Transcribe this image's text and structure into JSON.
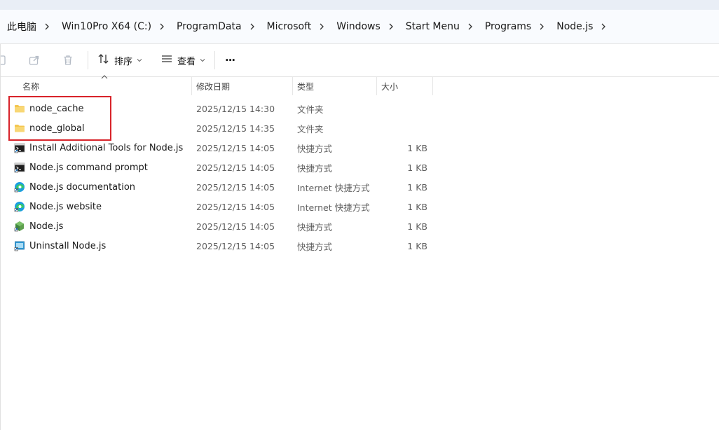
{
  "breadcrumb": {
    "items": [
      "此电脑",
      "Win10Pro X64 (C:)",
      "ProgramData",
      "Microsoft",
      "Windows",
      "Start Menu",
      "Programs",
      "Node.js"
    ]
  },
  "toolbar": {
    "sort_label": "排序",
    "view_label": "查看",
    "more_label": "···"
  },
  "columns": {
    "name": "名称",
    "date": "修改日期",
    "type": "类型",
    "size": "大小"
  },
  "files": [
    {
      "name": "node_cache",
      "date": "2025/12/15 14:30",
      "type": "文件夹",
      "size": "",
      "icon": "folder-icon"
    },
    {
      "name": "node_global",
      "date": "2025/12/15 14:35",
      "type": "文件夹",
      "size": "",
      "icon": "folder-icon"
    },
    {
      "name": "Install Additional Tools for Node.js",
      "date": "2025/12/15 14:05",
      "type": "快捷方式",
      "size": "1 KB",
      "icon": "terminal-shortcut-icon"
    },
    {
      "name": "Node.js command prompt",
      "date": "2025/12/15 14:05",
      "type": "快捷方式",
      "size": "1 KB",
      "icon": "terminal-shortcut-icon"
    },
    {
      "name": "Node.js documentation",
      "date": "2025/12/15 14:05",
      "type": "Internet 快捷方式",
      "size": "1 KB",
      "icon": "edge-browser-icon"
    },
    {
      "name": "Node.js website",
      "date": "2025/12/15 14:05",
      "type": "Internet 快捷方式",
      "size": "1 KB",
      "icon": "edge-browser-icon"
    },
    {
      "name": "Node.js",
      "date": "2025/12/15 14:05",
      "type": "快捷方式",
      "size": "1 KB",
      "icon": "nodejs-hexagon-icon"
    },
    {
      "name": "Uninstall Node.js",
      "date": "2025/12/15 14:05",
      "type": "快捷方式",
      "size": "1 KB",
      "icon": "uninstall-icon"
    }
  ],
  "colors": {
    "highlight": "#d8232a",
    "folder": "#f4c64f",
    "accent": "#0f6cbd"
  }
}
